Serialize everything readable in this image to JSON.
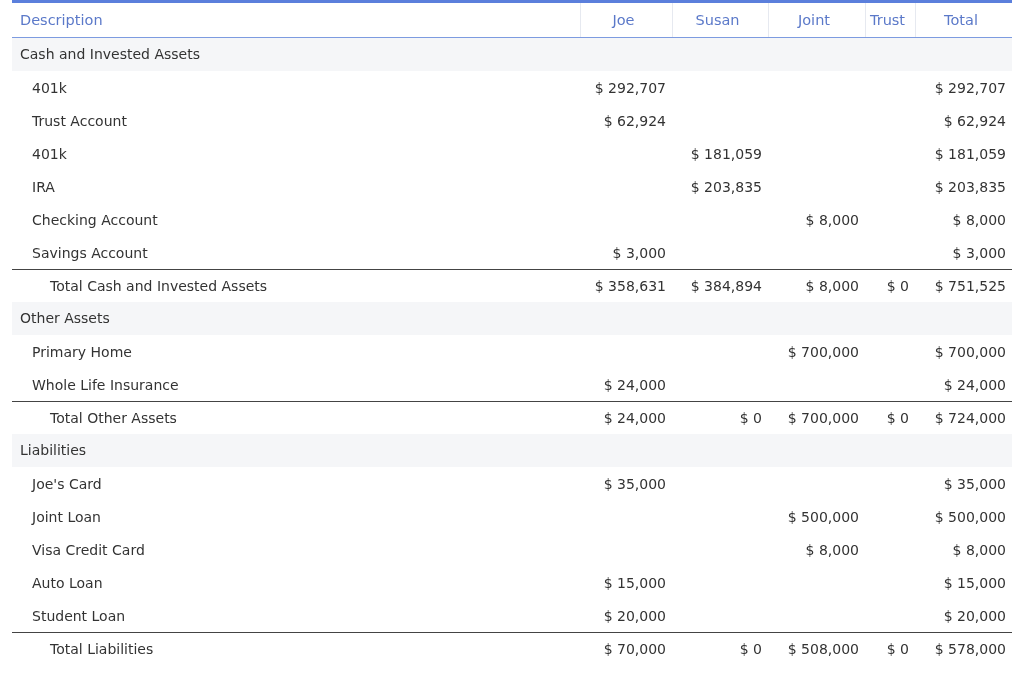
{
  "table": {
    "columns": [
      "Description",
      "Joe",
      "Susan",
      "Joint",
      "Trust",
      "Total"
    ],
    "rows": [
      {
        "kind": "section",
        "cells": [
          "Cash and Invested Assets"
        ]
      },
      {
        "kind": "item",
        "cells": [
          "401k",
          "$ 292,707",
          "",
          "",
          "",
          "$ 292,707"
        ]
      },
      {
        "kind": "item",
        "cells": [
          "Trust Account",
          "$ 62,924",
          "",
          "",
          "",
          "$ 62,924"
        ]
      },
      {
        "kind": "item",
        "cells": [
          "401k",
          "",
          "$ 181,059",
          "",
          "",
          "$ 181,059"
        ]
      },
      {
        "kind": "item",
        "cells": [
          "IRA",
          "",
          "$ 203,835",
          "",
          "",
          "$ 203,835"
        ]
      },
      {
        "kind": "item",
        "cells": [
          "Checking Account",
          "",
          "",
          "$ 8,000",
          "",
          "$ 8,000"
        ]
      },
      {
        "kind": "item",
        "cells": [
          "Savings Account",
          "$ 3,000",
          "",
          "",
          "",
          "$ 3,000"
        ]
      },
      {
        "kind": "total",
        "cells": [
          "Total Cash and Invested Assets",
          "$ 358,631",
          "$ 384,894",
          "$ 8,000",
          "$ 0",
          "$ 751,525"
        ]
      },
      {
        "kind": "section",
        "cells": [
          "Other Assets"
        ]
      },
      {
        "kind": "item",
        "cells": [
          "Primary Home",
          "",
          "",
          "$ 700,000",
          "",
          "$ 700,000"
        ]
      },
      {
        "kind": "item",
        "cells": [
          "Whole Life Insurance",
          "$ 24,000",
          "",
          "",
          "",
          "$ 24,000"
        ]
      },
      {
        "kind": "total",
        "cells": [
          "Total Other Assets",
          "$ 24,000",
          "$ 0",
          "$ 700,000",
          "$ 0",
          "$ 724,000"
        ]
      },
      {
        "kind": "section",
        "cells": [
          "Liabilities"
        ]
      },
      {
        "kind": "item",
        "cells": [
          "Joe's Card",
          "$ 35,000",
          "",
          "",
          "",
          "$ 35,000"
        ]
      },
      {
        "kind": "item",
        "cells": [
          "Joint Loan",
          "",
          "",
          "$ 500,000",
          "",
          "$ 500,000"
        ]
      },
      {
        "kind": "item",
        "cells": [
          "Visa Credit Card",
          "",
          "",
          "$ 8,000",
          "",
          "$ 8,000"
        ]
      },
      {
        "kind": "item",
        "cells": [
          "Auto Loan",
          "$ 15,000",
          "",
          "",
          "",
          "$ 15,000"
        ]
      },
      {
        "kind": "item",
        "cells": [
          "Student Loan",
          "$ 20,000",
          "",
          "",
          "",
          "$ 20,000"
        ]
      },
      {
        "kind": "total",
        "cells": [
          "Total Liabilities",
          "$ 70,000",
          "$ 0",
          "$ 508,000",
          "$ 0",
          "$ 578,000"
        ]
      }
    ]
  }
}
